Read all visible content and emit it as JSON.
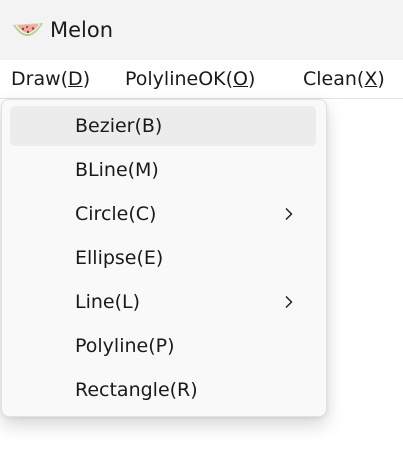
{
  "window": {
    "title": "Melon",
    "icon": "watermelon-icon"
  },
  "menubar": {
    "items": [
      {
        "label": "Draw(",
        "accel": "D",
        "suffix": ")"
      },
      {
        "label": "PolylineOK(",
        "accel": "O",
        "suffix": ")"
      },
      {
        "label": "Clean(",
        "accel": "X",
        "suffix": ")"
      }
    ]
  },
  "dropdown": {
    "items": [
      {
        "label": "Bezier(B)",
        "submenu": false,
        "highlighted": true
      },
      {
        "label": "BLine(M)",
        "submenu": false
      },
      {
        "label": "Circle(C)",
        "submenu": true,
        "submenu_icon": "chevron-right-icon"
      },
      {
        "label": "Ellipse(E)",
        "submenu": false
      },
      {
        "label": "Line(L)",
        "submenu": true,
        "submenu_icon": "chevron-right-icon"
      },
      {
        "label": "Polyline(P)",
        "submenu": false
      },
      {
        "label": "Rectangle(R)",
        "submenu": false
      }
    ]
  },
  "colors": {
    "titlebar_bg": "#f3f3f3",
    "menu_bg": "#f9f9f9",
    "highlight": "#ececec",
    "text": "#1a1a1a",
    "melon_flesh": "#f4a9a0",
    "melon_rind": "#9cc98a"
  }
}
